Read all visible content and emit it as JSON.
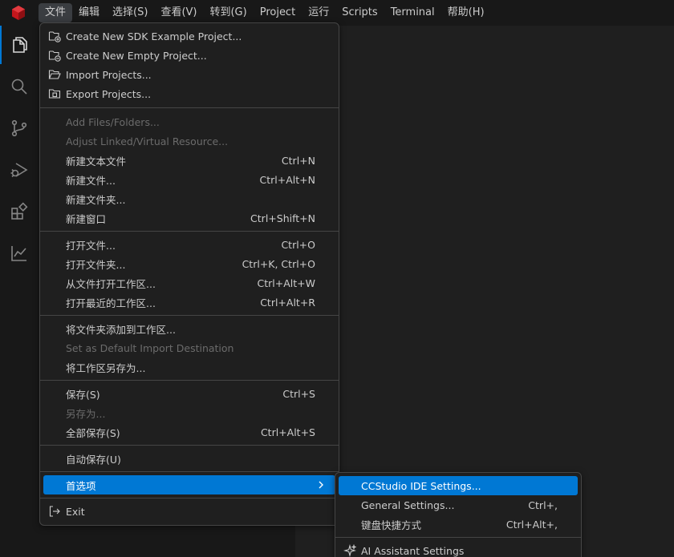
{
  "menubar": {
    "items": [
      "文件",
      "编辑",
      "选择(S)",
      "查看(V)",
      "转到(G)",
      "Project",
      "运行",
      "Scripts",
      "Terminal",
      "帮助(H)"
    ]
  },
  "activitybar": {
    "icons": [
      "files-icon",
      "search-icon",
      "source-control-icon",
      "run-debug-icon",
      "extensions-icon",
      "graph-icon"
    ]
  },
  "file_menu": {
    "group1": [
      {
        "label": "Create New SDK Example Project...",
        "icon": "new-project-icon"
      },
      {
        "label": "Create New Empty Project...",
        "icon": "new-project-icon"
      },
      {
        "label": "Import Projects...",
        "icon": "folder-open-icon"
      },
      {
        "label": "Export Projects...",
        "icon": "folder-export-icon"
      }
    ],
    "group2": [
      {
        "label": "Add Files/Folders...",
        "shortcut": ""
      },
      {
        "label": "Adjust Linked/Virtual Resource...",
        "shortcut": ""
      },
      {
        "label": "新建文本文件",
        "shortcut": "Ctrl+N"
      },
      {
        "label": "新建文件...",
        "shortcut": "Ctrl+Alt+N"
      },
      {
        "label": "新建文件夹...",
        "shortcut": ""
      },
      {
        "label": "新建窗口",
        "shortcut": "Ctrl+Shift+N"
      }
    ],
    "group3": [
      {
        "label": "打开文件...",
        "shortcut": "Ctrl+O"
      },
      {
        "label": "打开文件夹...",
        "shortcut": "Ctrl+K, Ctrl+O"
      },
      {
        "label": "从文件打开工作区...",
        "shortcut": "Ctrl+Alt+W"
      },
      {
        "label": "打开最近的工作区...",
        "shortcut": "Ctrl+Alt+R"
      }
    ],
    "group4": [
      {
        "label": "将文件夹添加到工作区...",
        "shortcut": ""
      },
      {
        "label": "Set as Default Import Destination",
        "shortcut": ""
      },
      {
        "label": "将工作区另存为...",
        "shortcut": ""
      }
    ],
    "group5": [
      {
        "label": "保存(S)",
        "shortcut": "Ctrl+S"
      },
      {
        "label": "另存为...",
        "shortcut": ""
      },
      {
        "label": "全部保存(S)",
        "shortcut": "Ctrl+Alt+S"
      }
    ],
    "autosave": "自动保存(U)",
    "preferences": "首选项",
    "exit": "Exit"
  },
  "pref_menu": {
    "items": [
      {
        "label": "CCStudio IDE Settings...",
        "shortcut": ""
      },
      {
        "label": "General Settings...",
        "shortcut": "Ctrl+,"
      },
      {
        "label": "键盘快捷方式",
        "shortcut": "Ctrl+Alt+,"
      },
      {
        "label": "AI Assistant Settings",
        "shortcut": ""
      }
    ]
  },
  "colors": {
    "accent": "#0078d4",
    "menu_bg": "#1f1f1f",
    "bar_bg": "#181818",
    "disabled_text": "#6b6b6b",
    "logo_red": "#c4161c"
  }
}
